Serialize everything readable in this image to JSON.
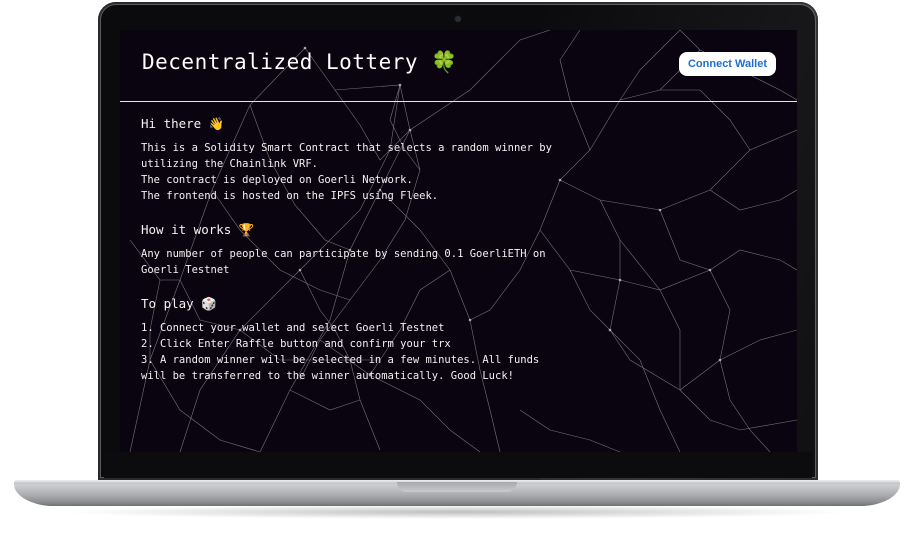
{
  "app": {
    "title": "Decentralized Lottery 🍀",
    "connect_button": "Connect Wallet"
  },
  "sections": [
    {
      "heading": "Hi there 👋",
      "lines": [
        "This is a Solidity Smart Contract that selects a random winner by",
        "utilizing the Chainlink VRF.",
        "The contract is deployed on Goerli Network.",
        "The frontend is hosted on the IPFS using Fleek."
      ]
    },
    {
      "heading": "How it works 🏆",
      "lines": [
        "Any number of people can participate by sending 0.1 GoerliETH on",
        "Goerli Testnet"
      ]
    },
    {
      "heading": "To play 🎲",
      "lines": [
        "1. Connect your wallet and select Goerli Testnet",
        "2. Click Enter Raffle button and confirm your trx",
        "3. A random winner will be selected in a few minutes. All funds",
        "will be transferred to the winner automatically. Good Luck!"
      ]
    }
  ],
  "colors": {
    "background": "#090410",
    "text": "#f2f2f2",
    "button_text": "#1e6fcf",
    "network_lines": "#9a97a3"
  }
}
